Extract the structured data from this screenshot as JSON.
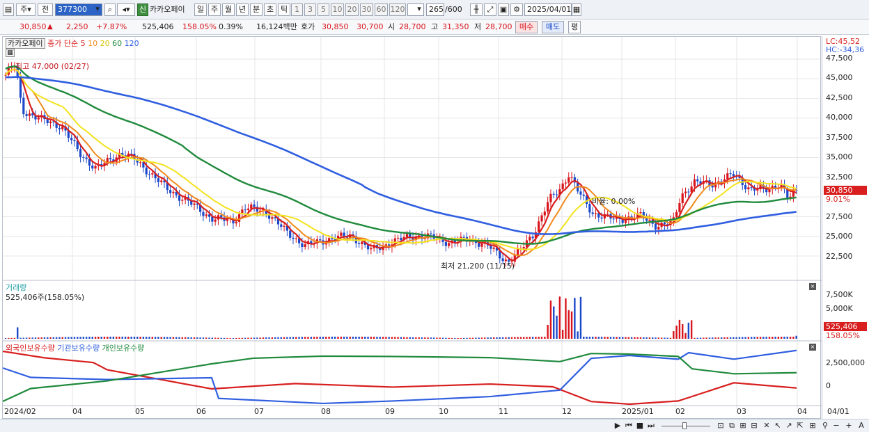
{
  "toolbar": {
    "market": "주",
    "prev": "전",
    "code": "377300",
    "sin_badge": "신",
    "stock_name": "카카오페이",
    "periods": [
      "일",
      "주",
      "월",
      "년",
      "분",
      "초",
      "틱"
    ],
    "selected_period": "일",
    "intervals": [
      "1",
      "3",
      "5",
      "10",
      "20",
      "30",
      "60",
      "120"
    ],
    "count": "265",
    "count_max": "/600",
    "date": "2025/04/01"
  },
  "quote": {
    "price": "30,850",
    "change": "2,250",
    "change_pct": "+7.87%",
    "volume": "525,406",
    "volume_ratio": "158.05%",
    "turnover": "0.39%",
    "amount": "16,124백만",
    "hoga_label": "호가",
    "ask": "30,850",
    "bid": "30,700",
    "open_label": "시",
    "open": "28,700",
    "high_label": "고",
    "high": "31,350",
    "low_label": "저",
    "low": "28,700",
    "buy_label": "매수",
    "sell_label": "매도",
    "avg_label": "평"
  },
  "price_panel": {
    "legend_name": "카카오페이",
    "legend_ma": "종가 단순",
    "ma_periods": [
      "5",
      "10",
      "20",
      "60",
      "120"
    ],
    "ma_colors": [
      "#d81e1e",
      "#f08a1c",
      "#f2e31d",
      "#1f8a3c",
      "#2f5ee0"
    ],
    "high_annot": "최고 47,000 (02/27)",
    "low_annot": "최저 21,200 (11/15)",
    "ratio_annot": "비율: 0.00%",
    "lc": "LC:45,52",
    "hc": "HC:-34,36",
    "last_price_tag": "30,850",
    "last_pct_tag": "9.01%",
    "yticks": [
      "47,500",
      "45,000",
      "42,500",
      "40,000",
      "37,500",
      "35,000",
      "32,500",
      "27,500",
      "25,000",
      "22,500"
    ]
  },
  "volume_panel": {
    "title": "거래량",
    "value": "525,406주(158.05%)",
    "yticks": [
      "7,500K",
      "5,000K"
    ],
    "last_tag": "525,406",
    "last_pct": "158.05%"
  },
  "holding_panel": {
    "legend": [
      "외국인보유수량",
      "기관보유수량",
      "개인보유수량"
    ],
    "colors": [
      "#d81e1e",
      "#2f5ee0",
      "#1f8a3c"
    ],
    "yticks": [
      "2,500,000",
      "0"
    ]
  },
  "xaxis": [
    "2024/02",
    "04",
    "05",
    "06",
    "07",
    "08",
    "09",
    "10",
    "11",
    "12",
    "2025/01",
    "02",
    "03",
    "04",
    "04/01"
  ]
}
